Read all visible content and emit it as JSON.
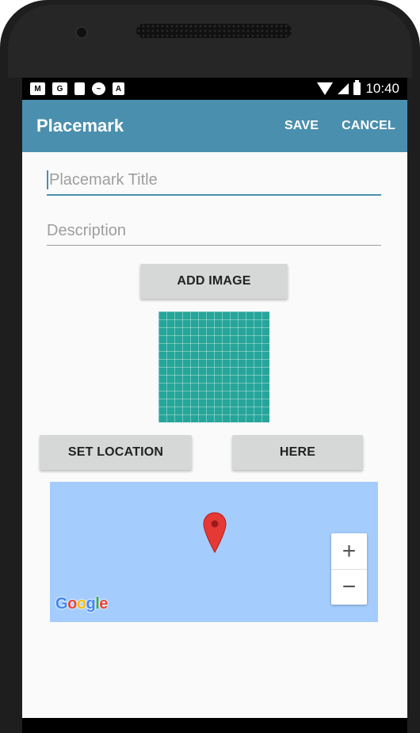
{
  "status_bar": {
    "time": "10:40",
    "icons": [
      "gmail-icon",
      "location-sim-icon",
      "sd-card-icon",
      "messenger-icon",
      "accessibility-icon"
    ]
  },
  "app_bar": {
    "title": "Placemark",
    "save_label": "SAVE",
    "cancel_label": "CANCEL",
    "color": "#4b8fae"
  },
  "form": {
    "title_placeholder": "Placemark Title",
    "title_value": "",
    "description_placeholder": "Description",
    "description_value": ""
  },
  "buttons": {
    "add_image": "ADD IMAGE",
    "set_location": "SET LOCATION",
    "here": "HERE"
  },
  "image": {
    "color": "#26a69a"
  },
  "map": {
    "background_color": "#a4cdfd",
    "zoom_in": "+",
    "zoom_out": "−",
    "logo": "Google",
    "marker_color": "#e53935"
  }
}
